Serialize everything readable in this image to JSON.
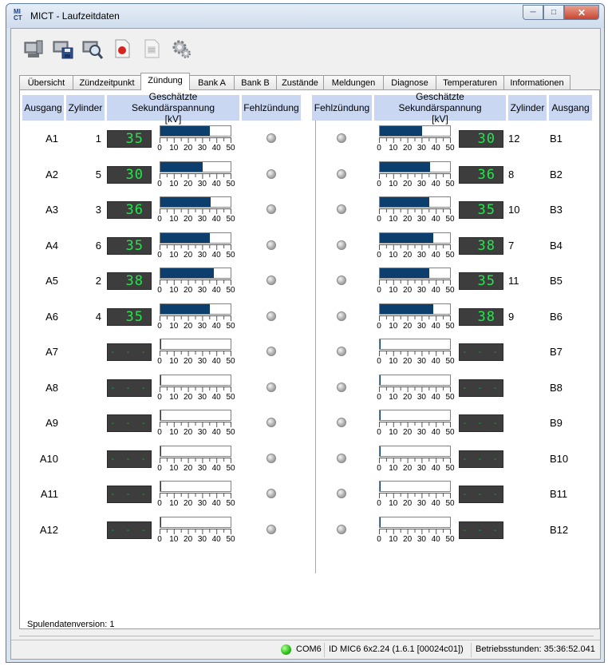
{
  "window": {
    "title": "MICT - Laufzeitdaten",
    "icon_text": "MI CT"
  },
  "tabs": [
    "Übersicht",
    "Zündzeitpunkt",
    "Zündung",
    "Bank A",
    "Bank B",
    "Zustände",
    "Meldungen",
    "Diagnose",
    "Temperaturen",
    "Informationen"
  ],
  "active_tab": "Zündung",
  "headers": {
    "left": {
      "ausgang": "Ausgang",
      "zylinder": "Zylinder",
      "spannung": "Geschätzte Sekundärspannung [kV]",
      "fehl": "Fehlzündung"
    },
    "right": {
      "fehl": "Fehlzündung",
      "spannung": "Geschätzte Sekundärspannung [kV]",
      "zylinder": "Zylinder",
      "ausgang": "Ausgang"
    }
  },
  "gauge_scale": {
    "min": 0,
    "max": 50,
    "labels": [
      "0",
      "10",
      "20",
      "30",
      "40",
      "50"
    ]
  },
  "empty_display": "- - -",
  "bank_a": [
    {
      "ausgang": "A1",
      "zylinder": "1",
      "display": "35",
      "kv": 35
    },
    {
      "ausgang": "A2",
      "zylinder": "5",
      "display": "30",
      "kv": 30
    },
    {
      "ausgang": "A3",
      "zylinder": "3",
      "display": "36",
      "kv": 36
    },
    {
      "ausgang": "A4",
      "zylinder": "6",
      "display": "35",
      "kv": 35
    },
    {
      "ausgang": "A5",
      "zylinder": "2",
      "display": "38",
      "kv": 38
    },
    {
      "ausgang": "A6",
      "zylinder": "4",
      "display": "35",
      "kv": 35
    },
    {
      "ausgang": "A7",
      "zylinder": "",
      "display": "",
      "kv": 0
    },
    {
      "ausgang": "A8",
      "zylinder": "",
      "display": "",
      "kv": 0
    },
    {
      "ausgang": "A9",
      "zylinder": "",
      "display": "",
      "kv": 0
    },
    {
      "ausgang": "A10",
      "zylinder": "",
      "display": "",
      "kv": 0
    },
    {
      "ausgang": "A11",
      "zylinder": "",
      "display": "",
      "kv": 0
    },
    {
      "ausgang": "A12",
      "zylinder": "",
      "display": "",
      "kv": 0
    }
  ],
  "bank_b": [
    {
      "ausgang": "B1",
      "zylinder": "12",
      "display": "30",
      "kv": 30
    },
    {
      "ausgang": "B2",
      "zylinder": "8",
      "display": "36",
      "kv": 36
    },
    {
      "ausgang": "B3",
      "zylinder": "10",
      "display": "35",
      "kv": 35
    },
    {
      "ausgang": "B4",
      "zylinder": "7",
      "display": "38",
      "kv": 38
    },
    {
      "ausgang": "B5",
      "zylinder": "11",
      "display": "35",
      "kv": 35
    },
    {
      "ausgang": "B6",
      "zylinder": "9",
      "display": "38",
      "kv": 38
    },
    {
      "ausgang": "B7",
      "zylinder": "",
      "display": "",
      "kv": 0
    },
    {
      "ausgang": "B8",
      "zylinder": "",
      "display": "",
      "kv": 0
    },
    {
      "ausgang": "B9",
      "zylinder": "",
      "display": "",
      "kv": 0
    },
    {
      "ausgang": "B10",
      "zylinder": "",
      "display": "",
      "kv": 0
    },
    {
      "ausgang": "B11",
      "zylinder": "",
      "display": "",
      "kv": 0
    },
    {
      "ausgang": "B12",
      "zylinder": "",
      "display": "",
      "kv": 0
    }
  ],
  "footer": {
    "version_label": "Spulendatenversion:",
    "version_value": "1"
  },
  "status": {
    "port": "COM6",
    "device": "ID MIC6 6x2.24 (1.6.1 [00024c01])",
    "hours": "Betriebsstunden: 35:36:52.041",
    "led_color": "#2fc31d"
  },
  "toolbar_icons": [
    "computer-icon",
    "save-icon",
    "search-report-icon",
    "record-icon",
    "document-icon",
    "settings-icon"
  ]
}
